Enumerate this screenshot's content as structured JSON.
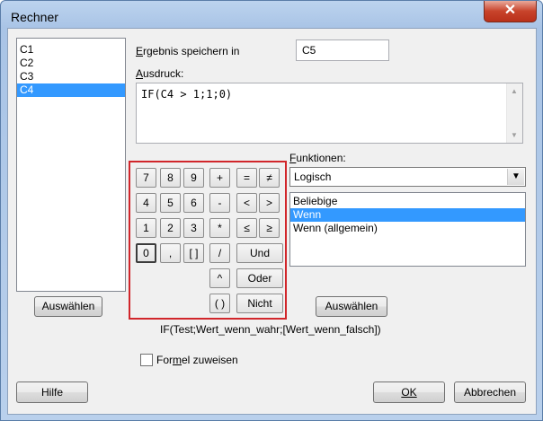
{
  "window": {
    "title": "Rechner",
    "close_glyph": "✕"
  },
  "variables": {
    "items": [
      "C1",
      "C2",
      "C3",
      "C4"
    ],
    "selected": "C4"
  },
  "ergebnis": {
    "label": "Ergebnis speichern in",
    "value": "C5"
  },
  "ausdruck": {
    "label": "Ausdruck:",
    "value": "IF(C4 > 1;1;0)"
  },
  "keypad": {
    "row1": [
      "7",
      "8",
      "9",
      "+",
      "=",
      "≠"
    ],
    "row2": [
      "4",
      "5",
      "6",
      "-",
      "<",
      ">"
    ],
    "row3": [
      "1",
      "2",
      "3",
      "*",
      "≤",
      "≥"
    ],
    "row4": [
      "0",
      ",",
      "[ ]",
      "/",
      "Und"
    ],
    "row5": [
      "^",
      "Oder"
    ],
    "row6": [
      "( )",
      "Nicht"
    ]
  },
  "funktionen": {
    "label": "Funktionen:",
    "combo_value": "Logisch",
    "items": [
      "Beliebige",
      "Wenn",
      "Wenn (allgemein)"
    ],
    "selected": "Wenn"
  },
  "buttons": {
    "auswaehlen_left": "Auswählen",
    "auswaehlen_right": "Auswählen",
    "hilfe": "Hilfe",
    "ok": "OK",
    "abbrechen": "Abbrechen"
  },
  "syntax_hint": "IF(Test;Wert_wenn_wahr;[Wert_wenn_falsch])",
  "formel": {
    "label": "Formel zuweisen",
    "checked": false
  },
  "highlight_color": "#d1262b",
  "selection_color": "#3399ff"
}
